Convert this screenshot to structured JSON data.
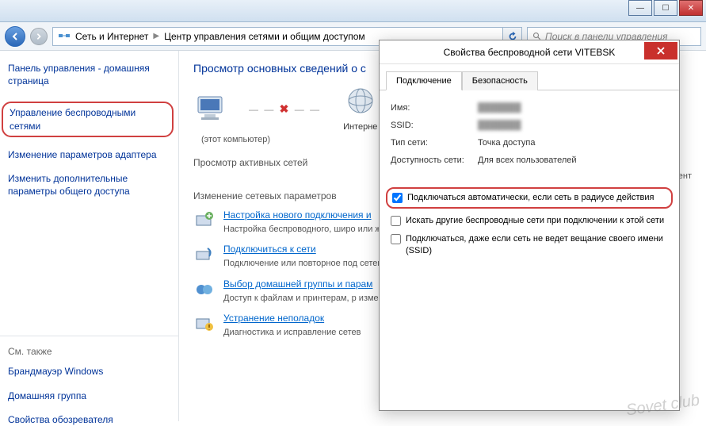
{
  "window": {
    "minimize": "—",
    "maximize": "☐",
    "close": "✕"
  },
  "addressbar": {
    "crumb1": "Сеть и Интернет",
    "crumb2": "Центр управления сетями и общим доступом",
    "search_placeholder": "Поиск в панели управления"
  },
  "sidebar": {
    "home": "Панель управления - домашняя страница",
    "links": [
      "Управление беспроводными сетями",
      "Изменение параметров адаптера",
      "Изменить дополнительные параметры общего доступа"
    ],
    "footer_head": "См. также",
    "footer": [
      "Брандмауэр Windows",
      "Домашняя группа",
      "Свойства обозревателя"
    ]
  },
  "main": {
    "title": "Просмотр основных сведений о с",
    "node_this": "(этот компьютер)",
    "node_internet": "Интерне",
    "section_active_head": "Просмотр активных сетей",
    "section_active_sub": "В данный момент",
    "section_change_head": "Изменение сетевых параметров",
    "tasks": [
      {
        "link": "Настройка нового подключения и",
        "desc": "Настройка беспроводного, широ\nили же настройка маршрутизатор"
      },
      {
        "link": "Подключиться к сети",
        "desc": "Подключение или повторное под\nсетевому соединению или подкл"
      },
      {
        "link": "Выбор домашней группы и парам",
        "desc": "Доступ к файлам и принтерам, р\nизменение параметров общего д"
      },
      {
        "link": "Устранение неполадок",
        "desc": "Диагностика и исправление сетев"
      }
    ]
  },
  "dialog": {
    "title": "Свойства беспроводной сети VITEBSK",
    "tabs": [
      "Подключение",
      "Безопасность"
    ],
    "rows": {
      "name_label": "Имя:",
      "ssid_label": "SSID:",
      "type_label": "Тип сети:",
      "type_value": "Точка доступа",
      "avail_label": "Доступность сети:",
      "avail_value": "Для всех пользователей"
    },
    "checkboxes": [
      "Подключаться автоматически, если сеть в радиусе действия",
      "Искать другие беспроводные сети при подключении к этой сети",
      "Подключаться, даже если сеть не ведет вещание своего имени (SSID)"
    ]
  },
  "watermark": "Sovet club"
}
